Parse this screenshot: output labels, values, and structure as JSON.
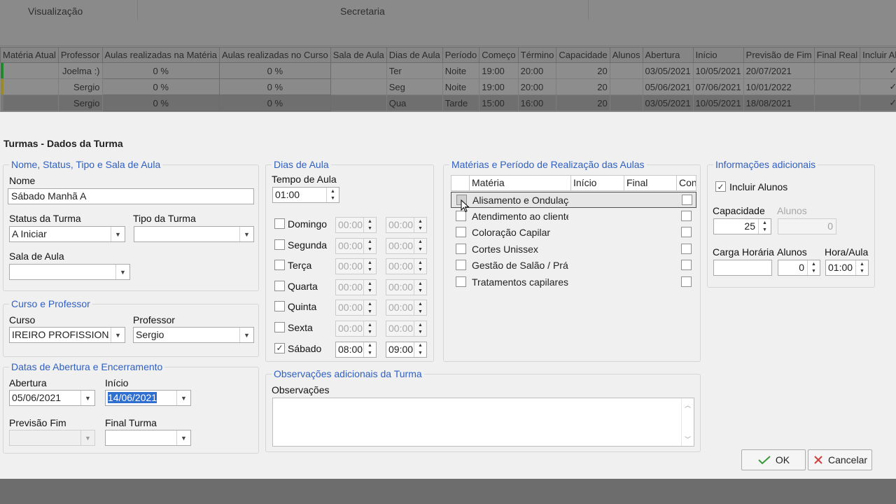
{
  "background": {
    "ribbon": {
      "group1": "Visualização",
      "group2": "Secretaria"
    },
    "grid": {
      "columns": [
        "Matéria Atual",
        "Professor",
        "Aulas realizadas na Matéria",
        "Aulas realizadas no Curso",
        "Sala de Aula",
        "Dias de Aula",
        "Período",
        "Começo",
        "Término",
        "Capacidade",
        "Alunos",
        "Abertura",
        "Início",
        "Previsão de Fim",
        "Final Real",
        "Incluir Al"
      ],
      "rows": [
        {
          "materia": "",
          "professor": "Joelma :)",
          "aulas_materia": "0 %",
          "aulas_curso": "0 %",
          "sala": "",
          "dias": "Ter",
          "periodo": "Noite",
          "comeco": "19:00",
          "termino": "20:00",
          "capacidade": "20",
          "alunos": "",
          "abertura": "03/05/2021",
          "inicio": "10/05/2021",
          "previsao": "20/07/2021",
          "final_real": "",
          "incluir": "✓",
          "marker": "#1f8a2c"
        },
        {
          "materia": "",
          "professor": "Sergio",
          "aulas_materia": "0 %",
          "aulas_curso": "0 %",
          "sala": "",
          "dias": "Seg",
          "periodo": "Noite",
          "comeco": "19:00",
          "termino": "20:00",
          "capacidade": "20",
          "alunos": "",
          "abertura": "05/06/2021",
          "inicio": "07/06/2021",
          "previsao": "10/01/2022",
          "final_real": "",
          "incluir": "✓",
          "marker": "#9a8a2a"
        },
        {
          "materia": "",
          "professor": "Sergio",
          "aulas_materia": "0 %",
          "aulas_curso": "0 %",
          "sala": "",
          "dias": "Qua",
          "periodo": "Tarde",
          "comeco": "15:00",
          "termino": "16:00",
          "capacidade": "20",
          "alunos": "",
          "abertura": "03/05/2021",
          "inicio": "10/05/2021",
          "previsao": "18/08/2021",
          "final_real": "",
          "incluir": "✓",
          "marker": "#7a7a7a"
        }
      ]
    }
  },
  "dialog": {
    "title": "Turmas - Dados da Turma",
    "group_nome": {
      "legend": "Nome, Status, Tipo e Sala de Aula",
      "nome_label": "Nome",
      "nome_value": "Sábado Manhã A",
      "status_label": "Status da Turma",
      "status_value": "A Iniciar",
      "tipo_label": "Tipo da Turma",
      "tipo_value": "",
      "sala_label": "Sala de Aula",
      "sala_value": ""
    },
    "group_curso": {
      "legend": "Curso e Professor",
      "curso_label": "Curso",
      "curso_value": "IREIRO PROFISSIONAL",
      "professor_label": "Professor",
      "professor_value": "Sergio"
    },
    "group_datas": {
      "legend": "Datas de Abertura e Encerramento",
      "abertura_label": "Abertura",
      "abertura_value": "05/06/2021",
      "inicio_label": "Início",
      "inicio_value": "14/06/2021",
      "previsao_label": "Previsão Fim",
      "previsao_value": "",
      "final_label": "Final Turma",
      "final_value": ""
    },
    "group_dias": {
      "legend": "Dias de Aula",
      "tempo_label": "Tempo de Aula",
      "tempo_value": "01:00",
      "days": [
        {
          "label": "Domingo",
          "checked": false,
          "start": "00:00",
          "end": "00:00"
        },
        {
          "label": "Segunda",
          "checked": false,
          "start": "00:00",
          "end": "00:00"
        },
        {
          "label": "Terça",
          "checked": false,
          "start": "00:00",
          "end": "00:00"
        },
        {
          "label": "Quarta",
          "checked": false,
          "start": "00:00",
          "end": "00:00"
        },
        {
          "label": "Quinta",
          "checked": false,
          "start": "00:00",
          "end": "00:00"
        },
        {
          "label": "Sexta",
          "checked": false,
          "start": "00:00",
          "end": "00:00"
        },
        {
          "label": "Sábado",
          "checked": true,
          "start": "08:00",
          "end": "09:00"
        }
      ]
    },
    "group_materias": {
      "legend": "Matérias e Período de Realização das Aulas",
      "headers": [
        "Matéria",
        "Início",
        "Final",
        "Con"
      ],
      "rows": [
        {
          "label": "Alisamento e Ondulação"
        },
        {
          "label": "Atendimento ao cliente"
        },
        {
          "label": "Coloração Capilar"
        },
        {
          "label": "Cortes Unissex"
        },
        {
          "label": "Gestão de Salão / Práticas"
        },
        {
          "label": "Tratamentos capilares,"
        }
      ]
    },
    "group_obs": {
      "legend": "Observações adicionais da Turma",
      "obs_label": "Observações",
      "obs_value": ""
    },
    "group_info": {
      "legend": "Informações adicionais",
      "incluir_label": "Incluir Alunos",
      "capacidade_label": "Capacidade",
      "capacidade_value": "25",
      "alunos_dim_label": "Alunos",
      "alunos_dim_value": "0",
      "carga_label": "Carga Horária",
      "carga_value": "",
      "alunos_label": "Alunos",
      "alunos_value": "0",
      "hora_label": "Hora/Aula",
      "hora_value": "01:00"
    },
    "buttons": {
      "ok": "OK",
      "cancel": "Cancelar"
    },
    "colors": {
      "legend": "#2f5fc2",
      "ok_check": "#3a9a3a",
      "cancel_x": "#d04040"
    }
  }
}
